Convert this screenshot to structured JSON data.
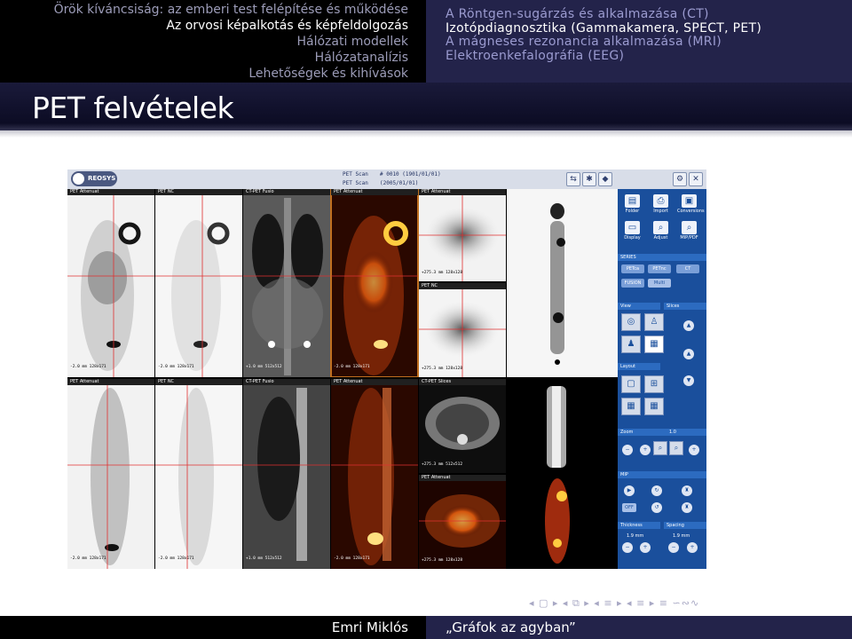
{
  "header": {
    "sections": [
      "Örök kíváncsiság: az emberi test felépítése és működése",
      "Az orvosi képalkotás és képfeldolgozás",
      "Hálózati modellek",
      "Hálózatanalízis",
      "Lehetőségek és kihívások"
    ],
    "current_section_index": 1,
    "subsections": [
      "A Röntgen-sugárzás és alkalmazása (CT)",
      "Izotópdiagnosztika (Gammakamera, SPECT, PET)",
      "A mágneses rezonancia alkalmazása (MRI)",
      "Elektroenkefalográfia (EEG)"
    ],
    "current_subsection_index": 1
  },
  "frame": {
    "title": "PET felvételek"
  },
  "screenshot": {
    "logo_text": "REOSYS",
    "scan_label": "PET Scan",
    "scan_id": "# 0010 (1901/01/01)",
    "scan_date": "(2005/01/01)",
    "panels": {
      "r1": [
        {
          "label": "PET Attenuat",
          "foot": "-2.0 mm  128x171"
        },
        {
          "label": "PET NC",
          "foot": "-2.0 mm  128x171"
        },
        {
          "label": "CT-PET Fusio",
          "foot": "+1.0 mm  512x512"
        },
        {
          "label": "PET Attenuat",
          "foot": "-2.0 mm  128x171"
        },
        {
          "label": "PET Attenuat",
          "foot": "+275.3 mm  128x128"
        },
        {
          "label": "PET NC",
          "foot": "+275.3 mm  128x128"
        }
      ],
      "r2": [
        {
          "label": "PET Attenuat",
          "foot": "-2.0 mm  128x171"
        },
        {
          "label": "PET NC",
          "foot": "-2.0 mm  128x171"
        },
        {
          "label": "CT-PET Fusio",
          "foot": "+1.0 mm  512x512"
        },
        {
          "label": "PET Attenuat",
          "foot": "-2.0 mm  128x171"
        },
        {
          "label": "CT-PET Slices",
          "foot": "+275.3 mm  512x512"
        },
        {
          "label": "PET Attenuat",
          "foot": "+275.3 mm  128x128"
        }
      ]
    },
    "controls": {
      "top_buttons": [
        "Folder",
        "Import",
        "Conversions",
        "Display",
        "Adjust",
        "MIP/PDF"
      ],
      "series_label": "SERIES",
      "series_buttons": [
        "PETca",
        "PETnc",
        "CT"
      ],
      "mode_buttons": [
        "FUSION",
        "Multi"
      ],
      "view_label": "View",
      "slices_label": "Slices",
      "layout_label": "Layout",
      "zoom_label": "Zoom",
      "zoom_value": "1.0",
      "mip_label": "MIP",
      "mip_off": "OFF",
      "thickness_label": "Thickness",
      "spacing_label": "Spacing",
      "thickness_value": "1.9 mm",
      "spacing_value": "1.9 mm"
    }
  },
  "footer": {
    "author": "Emri Miklós",
    "talk_title": "„Gráfok az agyban”",
    "nav_symbols": "◂ ▢ ▸  ◂ ⧉ ▸  ◂ ≡ ▸  ◂ ≡ ▸   ≡  ∽∾∿"
  },
  "colors": {
    "header_dark": "#000000",
    "header_navy": "#23234a",
    "pet_hot": "#ff7a10",
    "ui_blue": "#1a4f9c",
    "crosshair": "#e03030"
  }
}
